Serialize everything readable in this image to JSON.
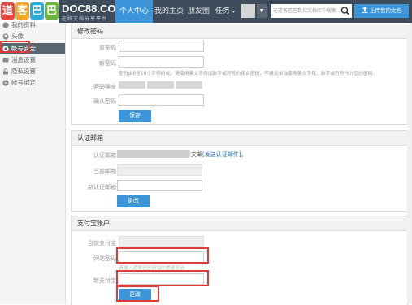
{
  "header": {
    "logo_chars": [
      "道",
      "客",
      "巴",
      "巴"
    ],
    "logo_colors": [
      "#e8473f",
      "#f4a52b",
      "#2fa8dc",
      "#6cb33f"
    ],
    "brand_name": "DOC88.COM",
    "brand_tagline": "在线文档分享平台",
    "nav": [
      {
        "label": "个人中心",
        "active": true
      },
      {
        "label": "我的主页",
        "active": false
      },
      {
        "label": "朋友圈",
        "active": false
      },
      {
        "label": "任务",
        "active": false
      }
    ],
    "search_placeholder": "在道客巴巴数亿文档库中搜索...",
    "upload_label": "上传我的文档",
    "accent": "#3b95d8"
  },
  "sidebar": {
    "items": [
      {
        "label": "我的资料",
        "icon": "user-icon"
      },
      {
        "label": "头像",
        "icon": "avatar-icon"
      },
      {
        "label": "帐号安全",
        "icon": "shield-icon",
        "active": true
      },
      {
        "label": "消息设置",
        "icon": "message-icon"
      },
      {
        "label": "隐私设置",
        "icon": "lock-icon"
      },
      {
        "label": "帐号绑定",
        "icon": "link-icon"
      }
    ]
  },
  "password_panel": {
    "title": "修改密码",
    "original_label": "原密码",
    "new_label": "新密码",
    "new_hint": "密码由6至16个字符组成，请使用英文字母加数字或符号的组合密码，不建议单独使用英文字母、数字或符号作为您的密码。",
    "strength_label": "密码强度",
    "confirm_label": "确认密码",
    "save_label": "保存"
  },
  "email_panel": {
    "title": "认证邮箱",
    "auth_label": "认证邮箱",
    "auth_suffix": "文邮",
    "resend_link": "[发送认证邮件]",
    "current_label": "当前邮箱",
    "new_label": "新认证邮箱",
    "change_label": "更改"
  },
  "alipay_panel": {
    "title": "支付宝账户",
    "current_label": "当前支付宝",
    "password_label": "网站密码",
    "password_hint": "请输入道客巴巴网站的登录密码",
    "new_label": "新支付宝",
    "change_label": "更改"
  }
}
